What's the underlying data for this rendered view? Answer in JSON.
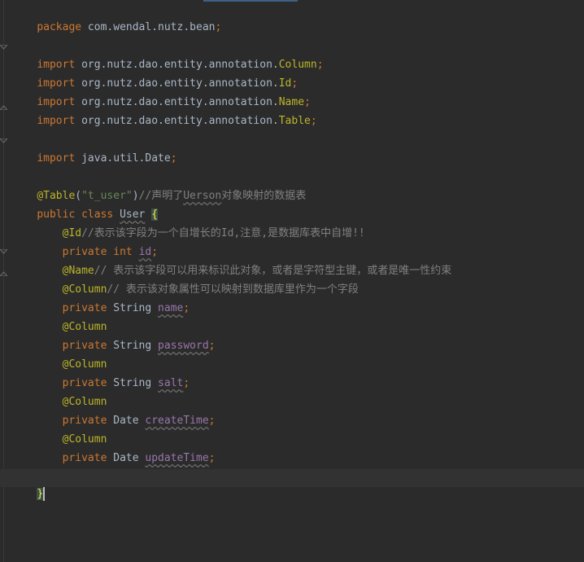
{
  "code": {
    "package_kw": "package",
    "package_name": " com.wendal.nutz.bean",
    "semicolon": ";",
    "import_kw": "import",
    "import_prefix": " org.nutz.dao.entity.annotation.",
    "import_column": "Column",
    "import_id": "Id",
    "import_name": "Name",
    "import_table": "Table",
    "import_date": " java.util.Date",
    "table_ann": "@Table",
    "table_paren_open": "(",
    "table_value": "\"t_user\"",
    "table_paren_close": ")",
    "table_comment_1": "//声明了",
    "table_comment_word": "Uerson",
    "table_comment_2": "对象映射的数据表",
    "public_kw": "public",
    "class_kw": "class",
    "class_name": "User",
    "open_brace": "{",
    "id_ann": "@Id",
    "id_comment": "//表示该字段为一个自增长的Id,注意,是数据库表中自增!!",
    "private_kw": "private",
    "int_kw": "int",
    "field_id": "id",
    "name_ann": "@Name",
    "name_comment": "// 表示该字段可以用来标识此对象，或者是字符型主键，或者是唯一性约束",
    "column_ann": "@Column",
    "column_comment": "// 表示该对象属性可以映射到数据库里作为一个字段",
    "type_string": "String",
    "type_date": "Date",
    "field_name": "name",
    "field_password": "password",
    "field_salt": "salt",
    "field_createTime": "createTime",
    "field_updateTime": "updateTime",
    "close_brace": "}"
  },
  "colors": {
    "background": "#2b2b2b",
    "keyword": "#cc7832",
    "annotation": "#bbb529",
    "string": "#6a8759",
    "comment": "#808080",
    "field": "#9876aa",
    "plain": "#a9b7c6"
  }
}
